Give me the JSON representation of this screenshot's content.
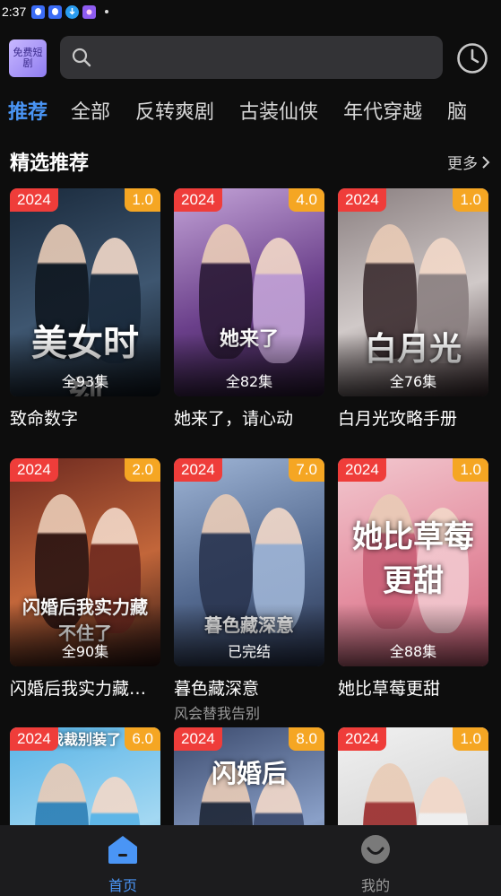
{
  "status_bar": {
    "time": "2:37",
    "icons": [
      {
        "name": "qq-icon",
        "color": "#3b6cf5"
      },
      {
        "name": "qq-icon",
        "color": "#3b6cf5"
      },
      {
        "name": "download-icon",
        "color": "#2a9cf0"
      },
      {
        "name": "photos-icon",
        "color": "#8e5cf0"
      }
    ]
  },
  "header": {
    "logo_text": "免费短剧",
    "search_placeholder": "",
    "history_icon": "clock-icon"
  },
  "tabs": [
    {
      "label": "推荐",
      "active": true
    },
    {
      "label": "全部"
    },
    {
      "label": "反转爽剧"
    },
    {
      "label": "古装仙侠"
    },
    {
      "label": "年代穿越"
    },
    {
      "label": "脑"
    }
  ],
  "section": {
    "title": "精选推荐",
    "more_label": "更多"
  },
  "cards": [
    {
      "year": "2024",
      "score": "1.0",
      "episodes": "全93集",
      "title": "致命数字",
      "subtitle": "",
      "poster_text": "美女时刻",
      "palette": [
        "#1a2a3c",
        "#3e5670",
        "#0f1720"
      ]
    },
    {
      "year": "2024",
      "score": "4.0",
      "episodes": "全82集",
      "title": "她来了，请心动",
      "subtitle": "",
      "poster_text": "她来了",
      "palette": [
        "#c4a4d8",
        "#6a3f8a",
        "#2b1a36"
      ]
    },
    {
      "year": "2024",
      "score": "1.0",
      "episodes": "全76集",
      "title": "白月光攻略手册",
      "subtitle": "",
      "poster_text": "白月光",
      "palette": [
        "#8a7f80",
        "#d0c9c8",
        "#3c2d30"
      ]
    },
    {
      "year": "2024",
      "score": "2.0",
      "episodes": "全90集",
      "title": "闪婚后我实力藏不住了",
      "subtitle": "",
      "poster_text": "闪婚后我实力藏不住了",
      "palette": [
        "#6e2a20",
        "#c2663a",
        "#2a1412"
      ]
    },
    {
      "year": "2024",
      "score": "7.0",
      "episodes": "已完结",
      "title": "暮色藏深意",
      "subtitle": "风会替我告别",
      "poster_text": "暮色藏深意",
      "palette": [
        "#9fb5d6",
        "#546a90",
        "#2a3550"
      ]
    },
    {
      "year": "2024",
      "score": "1.0",
      "episodes": "全88集",
      "title": "她比草莓更甜",
      "subtitle": "",
      "poster_text": "她比草莓更甜",
      "palette": [
        "#f2c8cf",
        "#e48ea0",
        "#c95f76"
      ]
    },
    {
      "year": "2024",
      "score": "6.0",
      "episodes": "",
      "title": "",
      "subtitle": "",
      "poster_text": "我裁别装了",
      "palette": [
        "#58b3e6",
        "#a3d8f2",
        "#2d7fb5"
      ]
    },
    {
      "year": "2024",
      "score": "8.0",
      "episodes": "",
      "title": "",
      "subtitle": "",
      "poster_text": "闪婚后",
      "palette": [
        "#3c4b6e",
        "#8aa0c8",
        "#1e2636"
      ]
    },
    {
      "year": "2024",
      "score": "1.0",
      "episodes": "",
      "title": "",
      "subtitle": "",
      "poster_text": "",
      "palette": [
        "#f1f1f1",
        "#d4d4d4",
        "#9a2a2a"
      ]
    }
  ],
  "bottom_nav": {
    "home_label": "首页",
    "mine_label": "我的",
    "active_color": "#4a95f5",
    "inactive_color": "#9a9a9a"
  }
}
